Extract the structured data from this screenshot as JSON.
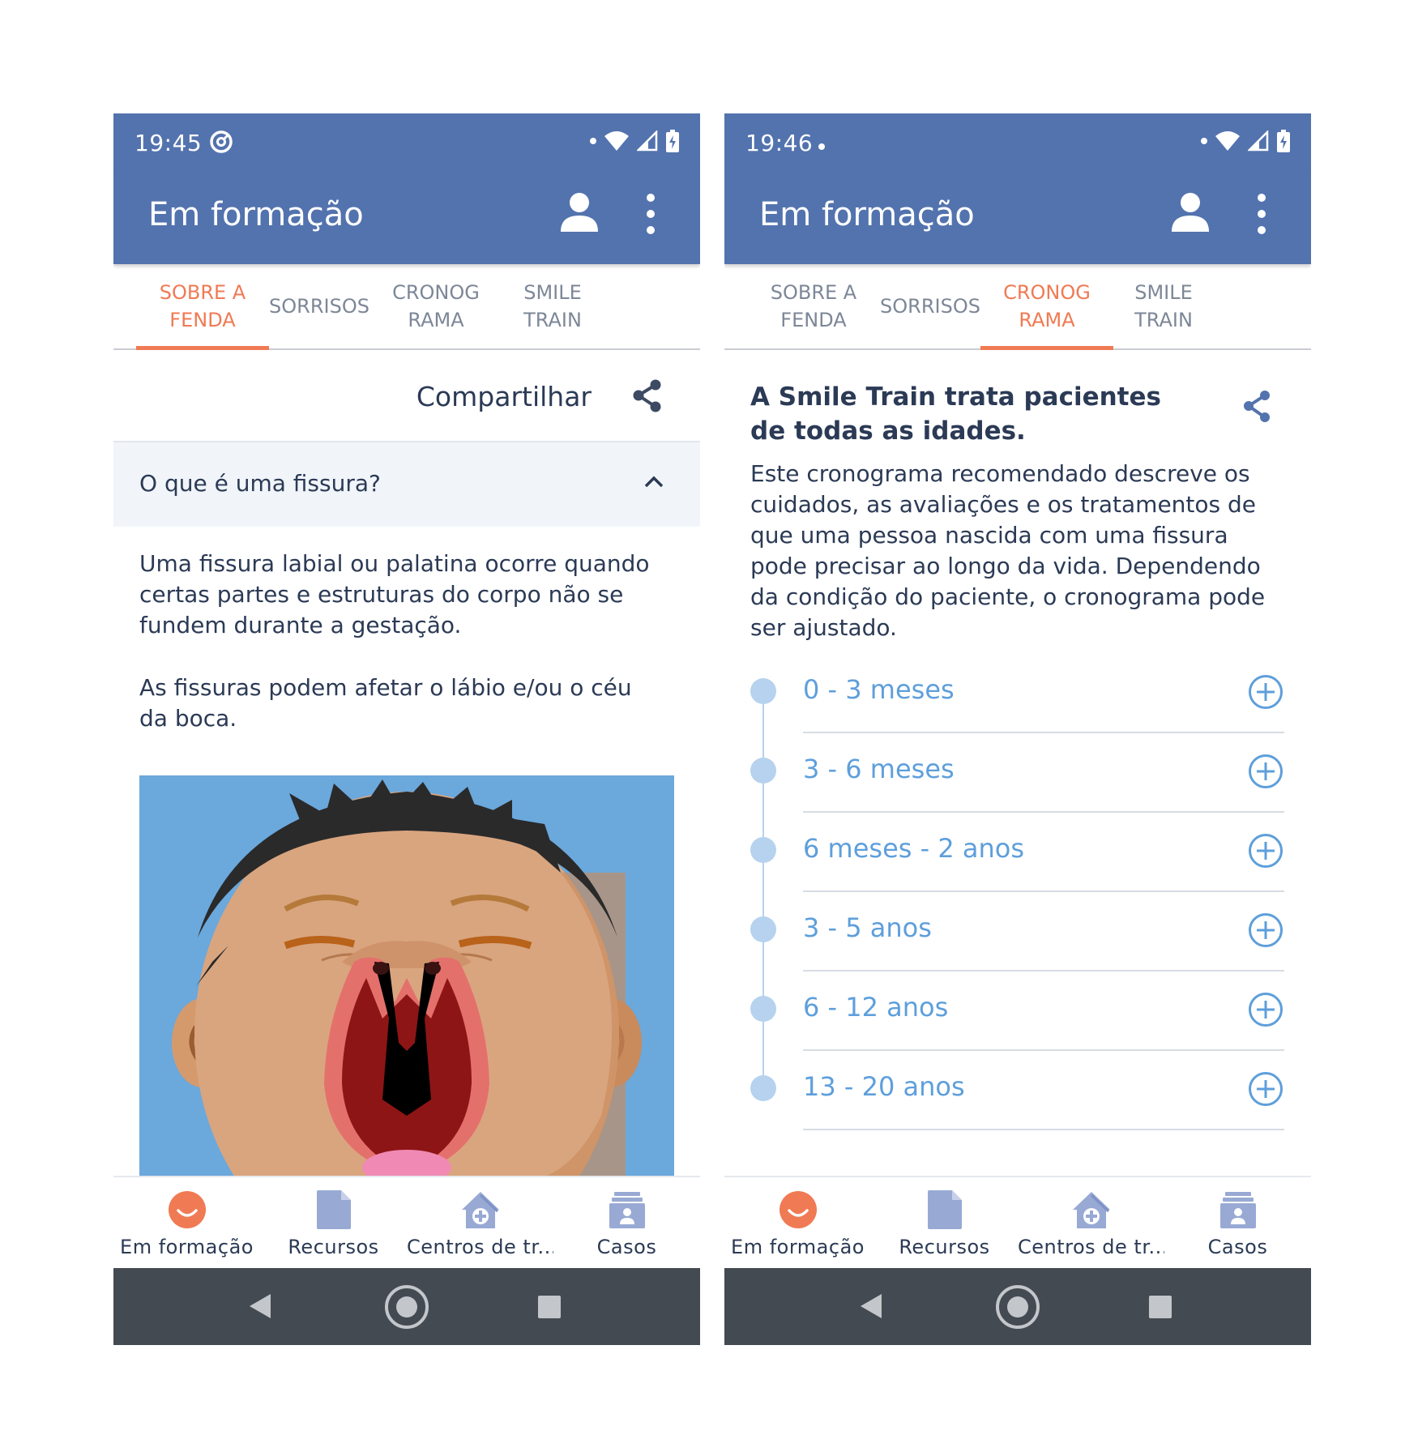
{
  "screens": [
    {
      "status_time": "19:45",
      "app_title": "Em formação",
      "tabs": [
        {
          "label": "SOBRE A\nFENDA",
          "active": true
        },
        {
          "label": "SORRISOS",
          "active": false
        },
        {
          "label": "CRONOG\nRAMA",
          "active": false
        },
        {
          "label": "SMILE\nTRAIN",
          "active": false
        }
      ],
      "share_label": "Compartilhar",
      "accordion_title": "O que é uma fissura?",
      "paragraphs": [
        "Uma fissura labial ou palatina ocorre quando certas partes e estruturas do corpo não se fundem durante a gestação.",
        "As fissuras podem afetar o lábio e/ou o céu da boca."
      ]
    },
    {
      "status_time": "19:46",
      "app_title": "Em formação",
      "tabs": [
        {
          "label": "SOBRE A\nFENDA",
          "active": false
        },
        {
          "label": "SORRISOS",
          "active": false
        },
        {
          "label": "CRONOG\nRAMA",
          "active": true
        },
        {
          "label": "SMILE\nTRAIN",
          "active": false
        }
      ],
      "headline": "A Smile Train trata pacientes de todas as idades.",
      "intro": "Este cronograma recomendado descreve os cuidados, as avaliações e os tratamentos de que uma pessoa nascida com uma fissura pode precisar ao longo da vida. Dependendo da condição do paciente, o cronograma pode ser ajustado.",
      "timeline": [
        "0 - 3 meses",
        "3 - 6 meses",
        "6 meses - 2 anos",
        "3 - 5 anos",
        "6 - 12 anos",
        "13 - 20 anos"
      ]
    }
  ],
  "bottom_nav": [
    {
      "label": "Em formação",
      "icon": "smile-icon",
      "active": true
    },
    {
      "label": "Recursos",
      "icon": "document-icon",
      "active": false
    },
    {
      "label": "Centros de tr...",
      "icon": "hospital-house-icon",
      "active": false
    },
    {
      "label": "Casos",
      "icon": "case-folder-icon",
      "active": false
    }
  ],
  "colors": {
    "primary": "#5373ae",
    "accent": "#f07a53",
    "timeline_blue": "#5e9fdb",
    "timeline_dot": "#b6d2ee",
    "illustration_bg": "#6ba8dc",
    "system_nav": "#444a51"
  }
}
